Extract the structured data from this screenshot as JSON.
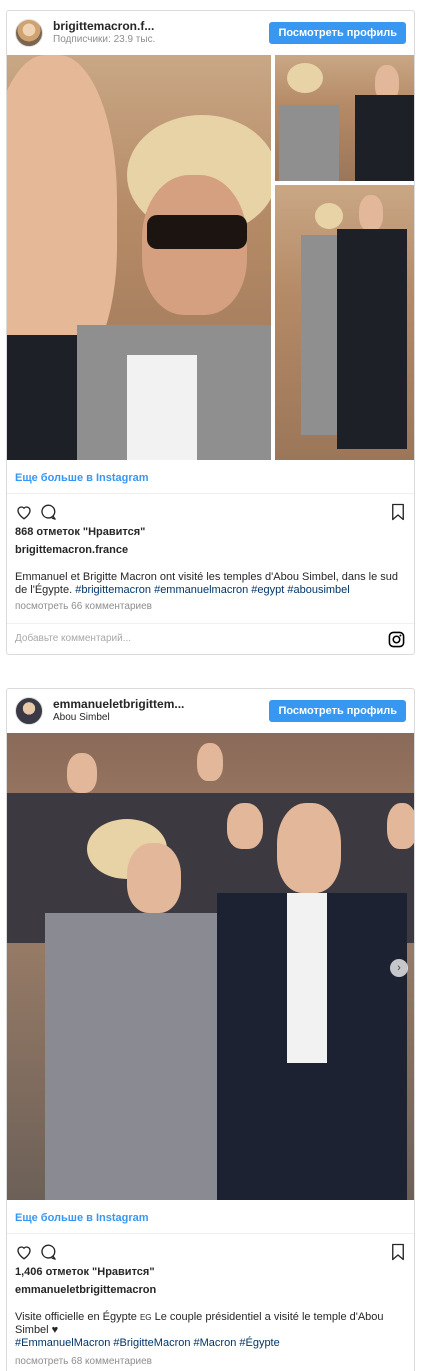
{
  "posts": [
    {
      "username": "brigittemacron.f...",
      "subtitle": "Подписчики: 23.9 тыс.",
      "follow_label": "Посмотреть профиль",
      "more_label": "Еще больше в Instagram",
      "likes": "868 отметок \"Нравится\"",
      "owner": "brigittemacron.france",
      "caption_text": "Emmanuel et Brigitte Macron ont visité les temples d'Abou Simbel, dans le sud de l'Égypte. ",
      "caption_tags": "#brigittemacron #emmanuelmacron #egypt #abousimbel",
      "comments": "посмотреть 66 комментариев",
      "add_comment_placeholder": "Добавьте комментарий..."
    },
    {
      "username": "emmanueletbrigittem...",
      "subtitle": "Abou Simbel",
      "follow_label": "Посмотреть профиль",
      "more_label": "Еще больше в Instagram",
      "likes": "1,406 отметок \"Нравится\"",
      "owner": "emmanueletbrigittemacron",
      "caption_text": "Visite officielle en Égypte ",
      "caption_flag": "EG",
      "caption_text2": " Le couple présidentiel a visité le temple d'Abou Simbel ♥",
      "caption_tags": "#EmmanuelMacron #BrigitteMacron #Macron #Égypte",
      "comments": "посмотреть 68 комментариев"
    }
  ],
  "icons": {
    "like": "heart-icon",
    "comment": "comment-icon",
    "save": "bookmark-icon",
    "instagram": "instagram-icon",
    "next": "chevron-right-icon"
  },
  "colors": {
    "accent": "#3897f0",
    "hashtag": "#003569",
    "muted": "#8e8e8e"
  }
}
